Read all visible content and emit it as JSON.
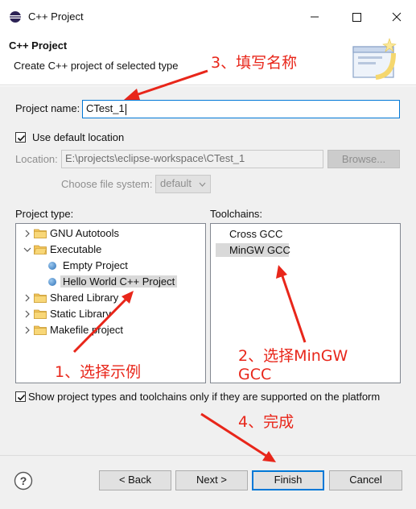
{
  "window": {
    "title": "C++ Project",
    "icon": "eclipse-icon",
    "controls": [
      "minimize-icon",
      "maximize-icon",
      "close-icon"
    ]
  },
  "header": {
    "title": "C++ Project",
    "subtitle": "Create C++ project of selected type"
  },
  "form": {
    "project_name_label": "Project name:",
    "project_name_value": "CTest_1",
    "use_default_location_label": "Use default location",
    "use_default_location_checked": true,
    "location_label": "Location:",
    "location_value": "E:\\projects\\eclipse-workspace\\CTest_1",
    "browse_label": "Browse...",
    "file_system_label": "Choose file system:",
    "file_system_value": "default"
  },
  "project_type": {
    "label": "Project type:",
    "items": [
      {
        "label": "GNU Autotools",
        "kind": "folder",
        "expanded": false
      },
      {
        "label": "Executable",
        "kind": "folder",
        "expanded": true
      },
      {
        "label": "Empty Project",
        "kind": "template"
      },
      {
        "label": "Hello World C++ Project",
        "kind": "template",
        "selected": true
      },
      {
        "label": "Shared Library",
        "kind": "folder",
        "expanded": false
      },
      {
        "label": "Static Library",
        "kind": "folder",
        "expanded": false
      },
      {
        "label": "Makefile project",
        "kind": "folder",
        "expanded": false
      }
    ]
  },
  "toolchains": {
    "label": "Toolchains:",
    "items": [
      {
        "label": "Cross GCC"
      },
      {
        "label": "MinGW GCC",
        "selected": true
      }
    ]
  },
  "filter": {
    "label": "Show project types and toolchains only if they are supported on the platform",
    "checked": true
  },
  "footer": {
    "back_label": "< Back",
    "next_label": "Next >",
    "finish_label": "Finish",
    "cancel_label": "Cancel"
  },
  "annotations": {
    "step1": "1、选择示例",
    "step2_line1": "2、选择MinGW",
    "step2_line2": "GCC",
    "step3": "3、填写名称",
    "step4": "4、完成",
    "color": "#e8261a"
  }
}
